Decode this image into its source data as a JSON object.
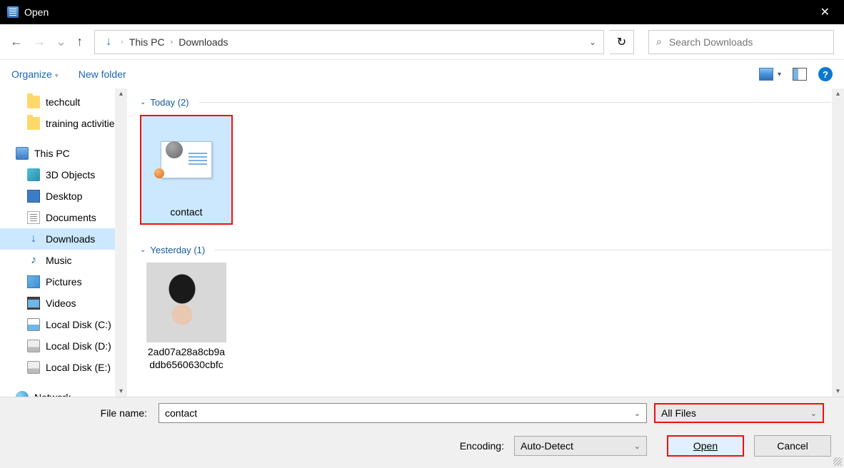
{
  "title": "Open",
  "breadcrumb": {
    "pc": "This PC",
    "folder": "Downloads"
  },
  "search": {
    "placeholder": "Search Downloads"
  },
  "toolbar": {
    "organize": "Organize",
    "newfolder": "New folder"
  },
  "sidebar": {
    "i0": "techcult",
    "i1": "training activities",
    "i2": "This PC",
    "i3": "3D Objects",
    "i4": "Desktop",
    "i5": "Documents",
    "i6": "Downloads",
    "i7": "Music",
    "i8": "Pictures",
    "i9": "Videos",
    "i10": "Local Disk (C:)",
    "i11": "Local Disk (D:)",
    "i12": "Local Disk (E:)",
    "i13": "Network"
  },
  "groups": {
    "today": "Today (2)",
    "yesterday": "Yesterday (1)"
  },
  "files": {
    "f0": "contact",
    "f1a": "2ad07a28a8cb9a",
    "f1b": "ddb6560630cbfc"
  },
  "bottom": {
    "filename_label": "File name:",
    "filename_value": "contact",
    "filter": "All Files",
    "encoding_label": "Encoding:",
    "encoding_value": "Auto-Detect",
    "open": "Open",
    "cancel": "Cancel"
  }
}
